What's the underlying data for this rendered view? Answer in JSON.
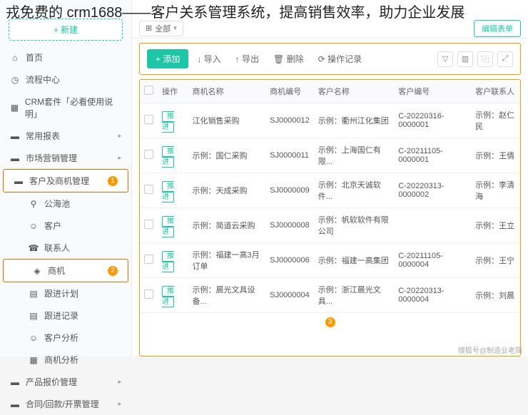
{
  "overlay_title": "戎免费的 crm1688——客户关系管理系统，提高销售效率，助力企业发展",
  "sidebar": {
    "new_btn": "+ 新建",
    "items": [
      {
        "icon": "⌂",
        "label": "首页"
      },
      {
        "icon": "◷",
        "label": "流程中心"
      },
      {
        "icon": "▦",
        "label": "CRM套件「必看使用说明」"
      },
      {
        "icon": "▬",
        "label": "常用报表"
      },
      {
        "icon": "▬",
        "label": "市场营销管理"
      },
      {
        "icon": "▬",
        "label": "客户及商机管理",
        "selected": true,
        "badge": "1"
      },
      {
        "icon": "⚲",
        "label": "公海池",
        "sub": true
      },
      {
        "icon": "☺",
        "label": "客户",
        "sub": true
      },
      {
        "icon": "☎",
        "label": "联系人",
        "sub": true
      },
      {
        "icon": "◈",
        "label": "商机",
        "sub": true,
        "selected": true,
        "badge": "2"
      },
      {
        "icon": "▤",
        "label": "跟进计划",
        "sub": true
      },
      {
        "icon": "▤",
        "label": "跟进记录",
        "sub": true
      },
      {
        "icon": "☺",
        "label": "客户分析",
        "sub": true
      },
      {
        "icon": "▦",
        "label": "商机分析",
        "sub": true
      },
      {
        "icon": "▬",
        "label": "产品报价管理"
      },
      {
        "icon": "▬",
        "label": "合同/回款/开票管理"
      }
    ]
  },
  "tabs": {
    "all": "全部",
    "grid": "⊞",
    "edit_form": "编辑表单"
  },
  "toolbar": {
    "add": "+ 添加",
    "import": "↓ 导入",
    "export": "↑ 导出",
    "delete": "🗑 删除",
    "log": "⟳ 操作记录"
  },
  "table": {
    "headers": [
      "",
      "操作",
      "商机名称",
      "商机编号",
      "客户名称",
      "客户编号",
      "客户联系人"
    ],
    "push_label": "推进",
    "rows": [
      {
        "name": "江化销售采购",
        "code": "SJ0000012",
        "cust": "示例：衢州江化集团",
        "ccode": "C-20220316-0000001",
        "contact": "示例：赵仁民"
      },
      {
        "name": "示例：国仁采购",
        "code": "SJ0000011",
        "cust": "示例：上海国仁有限...",
        "ccode": "C-20211105-0000001",
        "contact": "示例：王倩"
      },
      {
        "name": "示例：天成采购",
        "code": "SJ0000009",
        "cust": "示例：北京天诚软件...",
        "ccode": "C-20220313-0000002",
        "contact": "示例：李清海"
      },
      {
        "name": "示例：简道云采购",
        "code": "SJ0000008",
        "cust": "示例：帆软软件有限公司",
        "ccode": "",
        "contact": "示例：王立"
      },
      {
        "name": "示例：福建一高3月订单",
        "code": "SJ0000006",
        "cust": "示例：福建一高集团",
        "ccode": "C-20211105-0000004",
        "contact": "示例：王宁"
      },
      {
        "name": "示例：晨光文具设备...",
        "code": "SJ0000004",
        "cust": "示例：浙江晨光文具...",
        "ccode": "C-20220313-0000004",
        "contact": "示例：刘晨"
      }
    ],
    "footer_badge": "3"
  },
  "watermark": "搜狐号@制造业老简"
}
